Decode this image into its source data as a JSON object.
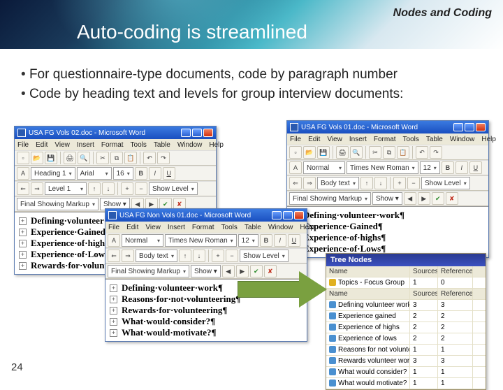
{
  "brand": "Nodes and Coding",
  "title": "Auto-coding is streamlined",
  "bullets": [
    "For questionnaire-type documents, code by paragraph number",
    "Code by heading text and levels for group interview documents:"
  ],
  "page": "24",
  "word1": {
    "caption": "USA FG Vols 02.doc - Microsoft Word",
    "menu": [
      "File",
      "Edit",
      "View",
      "Insert",
      "Format",
      "Tools",
      "Table",
      "Window",
      "Help"
    ],
    "style": "Heading 1",
    "font": "Arial",
    "size": "16",
    "outline": "Level 1",
    "showlevel": "Show Level",
    "markup": "Final Showing Markup",
    "showv": "Show ▾",
    "lines": [
      "Defining·volunteer·work¶",
      "Experience·Gained¶",
      "Experience·of·highs¶",
      "Experience·of·Lows¶",
      "Rewards·for·volunteering¶"
    ]
  },
  "word2": {
    "caption": "USA FG Vols 01.doc - Microsoft Word",
    "menu": [
      "File",
      "Edit",
      "View",
      "Insert",
      "Format",
      "Tools",
      "Table",
      "Window",
      "Help"
    ],
    "style": "Normal",
    "font": "Times New Roman",
    "size": "12",
    "outline": "Body text",
    "showlevel": "Show Level",
    "markup": "Final Showing Markup",
    "showv": "Show ▾",
    "lines": [
      "Defining·volunteer·work¶",
      "Experience·Gained¶",
      "Experience·of·highs¶",
      "Experience·of·Lows¶"
    ]
  },
  "word3": {
    "caption": "USA FG Non Vols 01.doc - Microsoft Word",
    "menu": [
      "File",
      "Edit",
      "View",
      "Insert",
      "Format",
      "Tools",
      "Table",
      "Window",
      "Help"
    ],
    "style": "Normal",
    "font": "Times New Roman",
    "size": "12",
    "outline": "Body text",
    "showlevel": "Show Level",
    "markup": "Final Showing Markup",
    "showv": "Show ▾",
    "lines": [
      "Defining·volunteer·work¶",
      "Reasons·for·not·volunteering¶",
      "Rewards·for·volunteering¶",
      "What·would·consider?¶",
      "What·would·motivate?¶"
    ]
  },
  "tree": {
    "title": "Tree Nodes",
    "cols": [
      "Name",
      "Sources",
      "References"
    ],
    "top": {
      "name": "Topics - Focus Group",
      "s": "1",
      "r": "0"
    },
    "cols2": [
      "Name",
      "Sources",
      "References"
    ],
    "rows": [
      {
        "name": "Defining volunteer work",
        "s": "3",
        "r": "3"
      },
      {
        "name": "Experience gained",
        "s": "2",
        "r": "2"
      },
      {
        "name": "Experience of highs",
        "s": "2",
        "r": "2"
      },
      {
        "name": "Experience of lows",
        "s": "2",
        "r": "2"
      },
      {
        "name": "Reasons for not volunteering",
        "s": "1",
        "r": "1"
      },
      {
        "name": "Rewards volunteer work",
        "s": "3",
        "r": "3"
      },
      {
        "name": "What would consider?",
        "s": "1",
        "r": "1"
      },
      {
        "name": "What would motivate?",
        "s": "1",
        "r": "1"
      }
    ]
  }
}
